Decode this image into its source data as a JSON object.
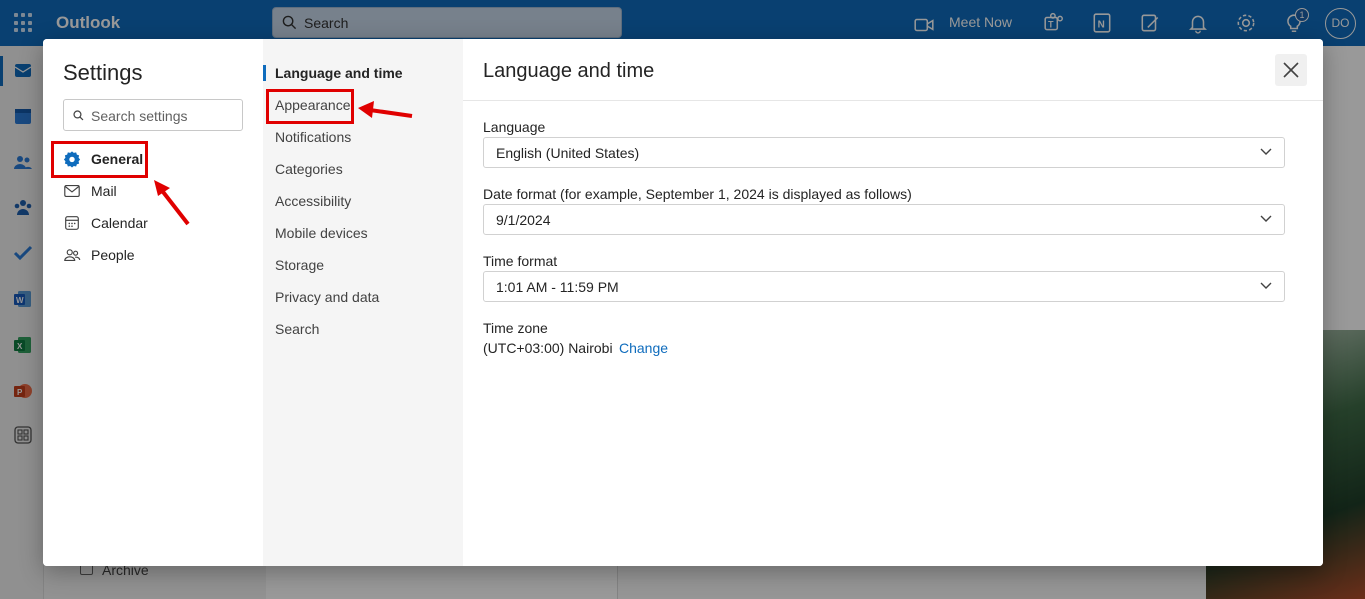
{
  "topbar": {
    "app_name": "Outlook",
    "search_placeholder": "Search",
    "meet_now": "Meet Now",
    "tips_badge": "1",
    "avatar_initials": "DO"
  },
  "background": {
    "folder_archive": "Archive"
  },
  "settings": {
    "title": "Settings",
    "search_placeholder": "Search settings",
    "categories": [
      {
        "label": "General",
        "icon": "gear-icon"
      },
      {
        "label": "Mail",
        "icon": "mail-icon"
      },
      {
        "label": "Calendar",
        "icon": "calendar-icon"
      },
      {
        "label": "People",
        "icon": "people-icon"
      }
    ],
    "subcategories": [
      "Language and time",
      "Appearance",
      "Notifications",
      "Categories",
      "Accessibility",
      "Mobile devices",
      "Storage",
      "Privacy and data",
      "Search"
    ],
    "active_subcategory": "Language and time",
    "page": {
      "title": "Language and time",
      "language_label": "Language",
      "language_value": "English (United States)",
      "date_format_label": "Date format (for example, September 1, 2024 is displayed as follows)",
      "date_format_value": "9/1/2024",
      "time_format_label": "Time format",
      "time_format_value": "1:01 AM - 11:59 PM",
      "time_zone_label": "Time zone",
      "time_zone_value": "(UTC+03:00) Nairobi",
      "time_zone_change": "Change"
    }
  },
  "colors": {
    "brand": "#0f6cbd",
    "annotation": "#e00000"
  }
}
